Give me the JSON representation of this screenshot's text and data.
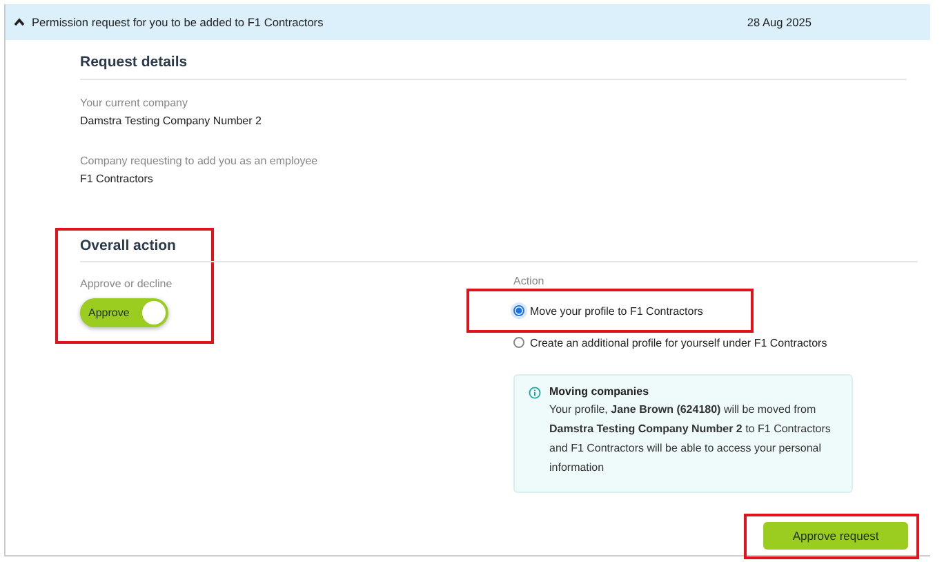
{
  "header": {
    "expanded": true,
    "title": "Permission request for you to be added to F1 Contractors",
    "date": "28 Aug 2025"
  },
  "request_details": {
    "heading": "Request details",
    "fields": [
      {
        "label": "Your current company",
        "value": "Damstra Testing Company Number 2"
      },
      {
        "label": "Company requesting to add you as an employee",
        "value": "F1 Contractors"
      }
    ]
  },
  "overall_action": {
    "heading": "Overall action",
    "highlighted": true,
    "decision": {
      "label": "Approve or decline",
      "toggle_text": "Approve",
      "on": true
    },
    "action": {
      "label": "Action",
      "options": [
        {
          "label": "Move your profile to F1 Contractors",
          "selected": true,
          "highlighted": true
        },
        {
          "label": "Create an additional profile for yourself under F1 Contractors",
          "selected": false,
          "highlighted": false
        }
      ]
    },
    "info": {
      "title": "Moving companies",
      "text": "Your profile, **Jane Brown (624180)** will be moved from **Damstra Testing Company Number 2** to F1 Contractors and F1 Contractors will be able to access your personal information"
    }
  },
  "approve_button": {
    "label": "Approve request",
    "highlighted": true
  }
}
